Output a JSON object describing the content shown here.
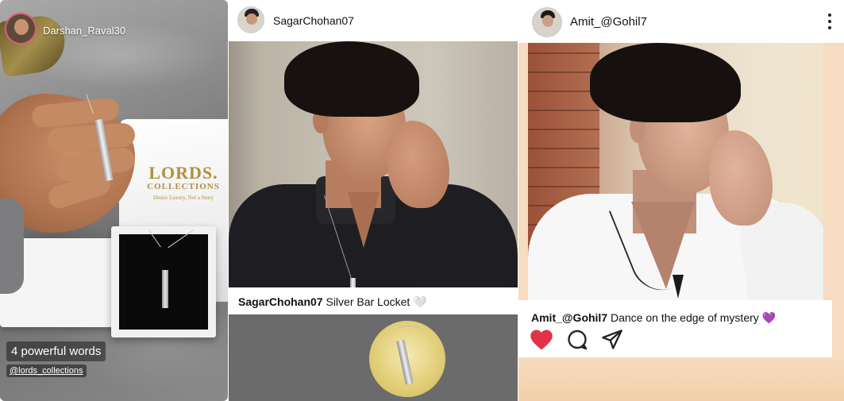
{
  "story": {
    "username": "Darshan_Raval30",
    "brand_line1": "LORDS.",
    "brand_line2": "COLLECTIONS",
    "brand_tagline": "Desire Luxury, Not a Story",
    "caption": "4 powerful words",
    "tag": "@lords_collections"
  },
  "post1": {
    "username": "SagarChohan07",
    "caption_user": "SagarChohan07",
    "caption_text": " Silver Bar Locket 🤍"
  },
  "post2": {
    "username": "Amit_@Gohil7",
    "caption_user": "Amit_@Gohil7",
    "caption_text": " Dance on the edge of mystery 💜",
    "like_color": "#e0334a"
  },
  "icons": [
    "like-heart-icon",
    "comment-icon",
    "share-icon",
    "more-options-icon"
  ]
}
